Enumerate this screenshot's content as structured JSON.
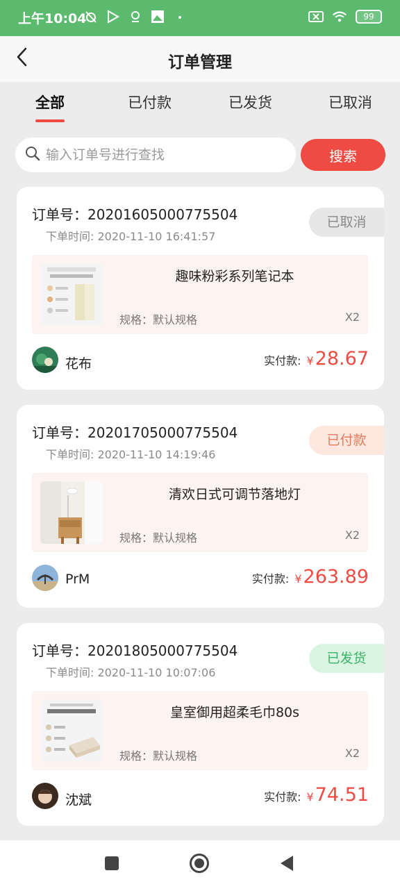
{
  "status_bar": {
    "time": "上午10:04",
    "battery": "99"
  },
  "header": {
    "title": "订单管理"
  },
  "tabs": [
    {
      "label": "全部",
      "active": true
    },
    {
      "label": "已付款",
      "active": false
    },
    {
      "label": "已发货",
      "active": false
    },
    {
      "label": "已取消",
      "active": false
    }
  ],
  "search": {
    "placeholder": "输入订单号进行查找",
    "value": "",
    "button_label": "搜索"
  },
  "orders": [
    {
      "order_no": "订单号：20201605000775504",
      "time": "下单时间: 2020-11-10 16:41:57",
      "status": "已取消",
      "product_name": "趣味粉彩系列笔记本",
      "spec": "规格：默认规格",
      "qty": "X2",
      "buyer": "花布",
      "pay_label": "实付款:",
      "currency": "¥",
      "amount": "28.67"
    },
    {
      "order_no": "订单号：20201705000775504",
      "time": "下单时间: 2020-11-10 14:19:46",
      "status": "已付款",
      "product_name": "清欢日式可调节落地灯",
      "spec": "规格：默认规格",
      "qty": "X2",
      "buyer": "PrM",
      "pay_label": "实付款:",
      "currency": "¥",
      "amount": "263.89"
    },
    {
      "order_no": "订单号：20201805000775504",
      "time": "下单时间: 2020-11-10 10:07:06",
      "status": "已发货",
      "product_name": "皇室御用超柔毛巾80s",
      "spec": "规格：默认规格",
      "qty": "X2",
      "buyer": "沈斌",
      "pay_label": "实付款:",
      "currency": "¥",
      "amount": "74.51"
    }
  ],
  "colors": {
    "status_bar": "#5cba6e",
    "accent": "#ef4b43",
    "cancel": "#888888",
    "paid": "#e3795d",
    "shipped": "#3bb366"
  },
  "icons": {
    "back": "back-arrow-icon",
    "search": "search-icon",
    "nav_recent": "square-icon",
    "nav_home": "circle-icon",
    "nav_back": "triangle-icon"
  }
}
